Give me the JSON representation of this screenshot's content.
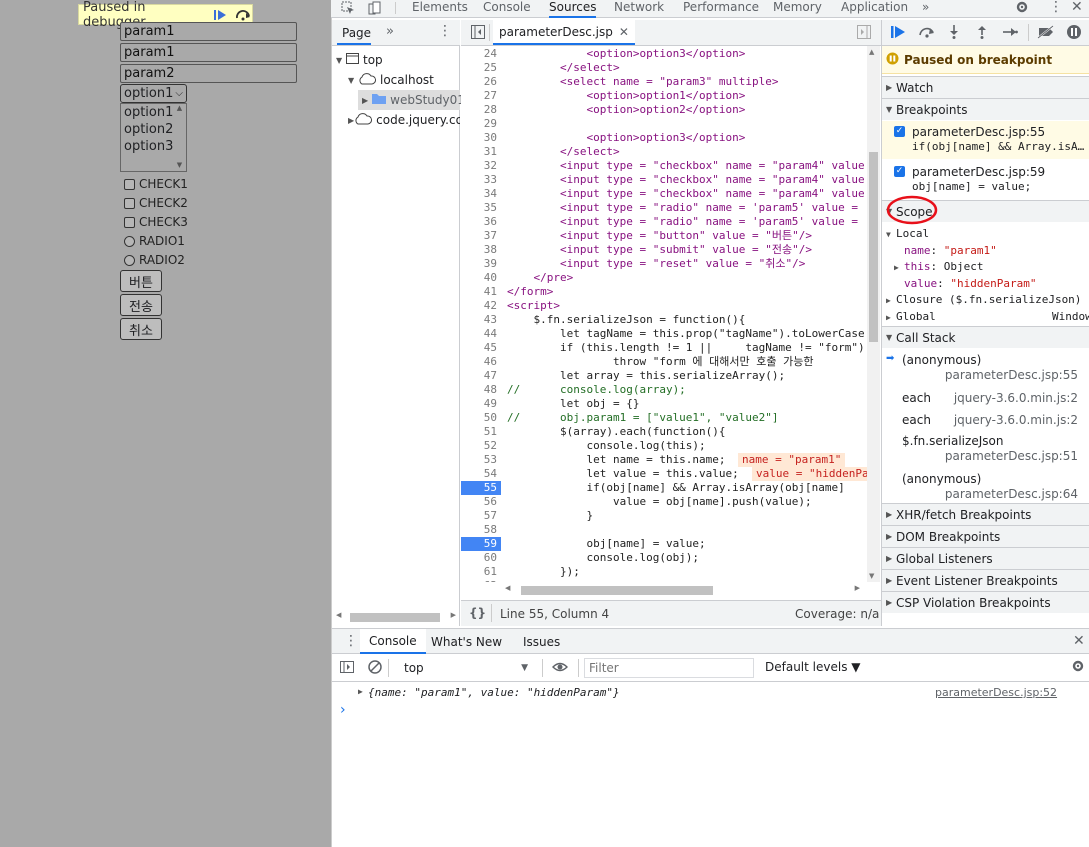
{
  "page": {
    "debugger_banner": "Paused in debugger",
    "inputs": [
      "param1",
      "param1",
      "param2"
    ],
    "select_value": "option1",
    "multi_options": [
      "option1",
      "option2",
      "option3"
    ],
    "checkboxes": [
      "CHECK1",
      "CHECK2",
      "CHECK3"
    ],
    "radios": [
      "RADIO1",
      "RADIO2"
    ],
    "buttons": [
      "버튼",
      "전송",
      "취소"
    ]
  },
  "devtools": {
    "tabs": [
      "Elements",
      "Console",
      "Sources",
      "Network",
      "Performance",
      "Memory",
      "Application"
    ],
    "active_tab": "Sources",
    "more_tabs": "»"
  },
  "navigator": {
    "tab": "Page",
    "more": "»",
    "tree": [
      {
        "label": "top"
      },
      {
        "label": "localhost"
      },
      {
        "label": "webStudy01"
      },
      {
        "label": "code.jquery.com"
      }
    ]
  },
  "editor": {
    "file_tab": "parameterDesc.jsp",
    "status_position": "Line 55, Column 4",
    "coverage": "Coverage: n/a",
    "format_btn": "{}",
    "lines": [
      {
        "n": "24",
        "t": "            <option>option3</option>"
      },
      {
        "n": "25",
        "t": "        </select>"
      },
      {
        "n": "26",
        "t": "        <select name = \"param3\" multiple>"
      },
      {
        "n": "27",
        "t": "            <option>option1</option>"
      },
      {
        "n": "28",
        "t": "            <option>option2</option>"
      },
      {
        "n": "29",
        "t": ""
      },
      {
        "n": "30",
        "t": "            <option>option3</option>"
      },
      {
        "n": "31",
        "t": "        </select>"
      },
      {
        "n": "32",
        "t": "        <input type = \"checkbox\" name = \"param4\" value"
      },
      {
        "n": "33",
        "t": "        <input type = \"checkbox\" name = \"param4\" value"
      },
      {
        "n": "34",
        "t": "        <input type = \"checkbox\" name = \"param4\" value"
      },
      {
        "n": "35",
        "t": "        <input type = \"radio\" name = 'param5' value ="
      },
      {
        "n": "36",
        "t": "        <input type = \"radio\" name = 'param5' value ="
      },
      {
        "n": "37",
        "t": "        <input type = \"button\" value = \"버튼\"/>"
      },
      {
        "n": "38",
        "t": "        <input type = \"submit\" value = \"전송\"/>"
      },
      {
        "n": "39",
        "t": "        <input type = \"reset\" value = \"취소\"/>"
      },
      {
        "n": "40",
        "t": "    </pre>"
      },
      {
        "n": "41",
        "t": "</form>"
      },
      {
        "n": "42",
        "t": "<script>"
      },
      {
        "n": "43",
        "t": "    $.fn.serializeJson = function(){"
      },
      {
        "n": "44",
        "t": "        let tagName = this.prop(\"tagName\").toLowerCase"
      },
      {
        "n": "45",
        "t": "        if (this.length != 1 ||     tagName != \"form\")"
      },
      {
        "n": "46",
        "t": "                throw \"form 에 대해서만 호출 가능한"
      },
      {
        "n": "47",
        "t": "        let array = this.serializeArray();"
      },
      {
        "n": "48",
        "t": "//      console.log(array);"
      },
      {
        "n": "49",
        "t": "        let obj = {}"
      },
      {
        "n": "50",
        "t": "//      obj.param1 = [\"value1\", \"value2\"]"
      },
      {
        "n": "51",
        "t": "        $(array).each(function(){"
      },
      {
        "n": "52",
        "t": "            console.log(this);"
      },
      {
        "n": "53",
        "t": "            let name = this.name;  "
      },
      {
        "n": "54",
        "t": "            let value = this.value;  "
      },
      {
        "n": "55",
        "t": "            if(obj[name] && Array.isArray(obj[name]"
      },
      {
        "n": "56",
        "t": "                value = obj[name].push(value);"
      },
      {
        "n": "57",
        "t": "            }"
      },
      {
        "n": "58",
        "t": ""
      },
      {
        "n": "59",
        "t": "            obj[name] = value;"
      },
      {
        "n": "60",
        "t": "            console.log(obj);"
      },
      {
        "n": "61",
        "t": "        });"
      },
      {
        "n": "62",
        "t": ""
      }
    ],
    "inline_values": [
      {
        "line": "53",
        "text": "name = \"param1\""
      },
      {
        "line": "54",
        "text": "value = \"hiddenPa"
      }
    ]
  },
  "debugger": {
    "paused_msg": "Paused on breakpoint",
    "watch": "Watch",
    "breakpoints": "Breakpoints",
    "bp_list": [
      {
        "file": "parameterDesc.jsp:55",
        "code": "if(obj[name] && Array.isA…"
      },
      {
        "file": "parameterDesc.jsp:59",
        "code": "obj[name] = value;"
      }
    ],
    "scope": "Scope",
    "local": "Local",
    "local_vars": [
      {
        "k": "name",
        "v": "\"param1\""
      },
      {
        "k": "this",
        "v": "Object"
      },
      {
        "k": "value",
        "v": "\"hiddenParam\""
      }
    ],
    "closure": "Closure ($.fn.serializeJson)",
    "global": "Global",
    "global_val": "Window",
    "call_stack": "Call Stack",
    "frames": [
      {
        "fn": "(anonymous)",
        "loc": "parameterDesc.jsp:55"
      },
      {
        "fn": "each",
        "loc": "jquery-3.6.0.min.js:2"
      },
      {
        "fn": "each",
        "loc": "jquery-3.6.0.min.js:2"
      },
      {
        "fn": "$.fn.serializeJson",
        "loc": "parameterDesc.jsp:51"
      },
      {
        "fn": "(anonymous)",
        "loc": "parameterDesc.jsp:64"
      }
    ],
    "more_sections": [
      "XHR/fetch Breakpoints",
      "DOM Breakpoints",
      "Global Listeners",
      "Event Listener Breakpoints",
      "CSP Violation Breakpoints"
    ]
  },
  "console": {
    "tabs": [
      "Console",
      "What's New",
      "Issues"
    ],
    "context": "top",
    "filter_placeholder": "Filter",
    "levels": "Default levels ▼",
    "log_obj": "{name: \"param1\", value: \"hiddenParam\"}",
    "log_src": "parameterDesc.jsp:52",
    "prompt": "›"
  },
  "colors": {
    "accent": "#1a73e8",
    "page_bg": "#a9a9a9",
    "banner": "#ffffc1",
    "annotation": "#e8101a"
  }
}
